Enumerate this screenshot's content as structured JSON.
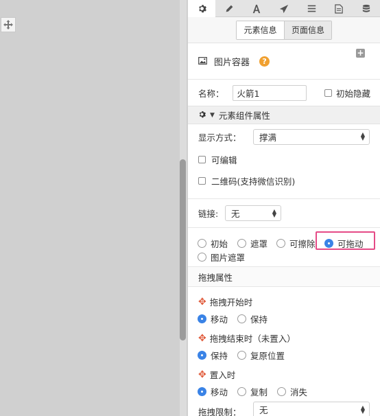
{
  "toolbar": {
    "tools": [
      "gear-icon",
      "pencil-icon",
      "text-icon",
      "send-icon",
      "list-icon",
      "document-icon",
      "database-icon"
    ],
    "active_index": 0
  },
  "tabs": {
    "element_info": "元素信息",
    "page_info": "页面信息"
  },
  "component": {
    "title": "图片容器",
    "help": "?",
    "add": "+"
  },
  "name_row": {
    "label": "名称：",
    "value": "火箭1",
    "initial_hide": "初始隐藏"
  },
  "group": {
    "title": "元素组件属性"
  },
  "display": {
    "label": "显示方式：",
    "value": "撑满"
  },
  "options": {
    "editable": "可编辑",
    "qrcode": "二维码(支持微信识别)"
  },
  "link": {
    "label": "链接:",
    "value": "无"
  },
  "mode": {
    "items": [
      "初始",
      "遮罩",
      "可擦除",
      "可拖动",
      "图片遮罩"
    ],
    "selected": "可拖动"
  },
  "drag": {
    "section_title": "拖拽属性",
    "start_title": "拖拽开始时",
    "start_options": [
      "移动",
      "保持"
    ],
    "start_selected": "移动",
    "end_title": "拖拽结束时（未置入）",
    "end_options": [
      "保持",
      "复原位置"
    ],
    "end_selected": "保持",
    "drop_title": "置入时",
    "drop_options": [
      "移动",
      "复制",
      "消失"
    ],
    "drop_selected": "移动",
    "limit_label": "拖拽限制：",
    "limit_value": "无"
  },
  "colors": {
    "accent": "#3a83e6",
    "highlight": "#e54a86",
    "help": "#f0a030",
    "drag_icon": "#e05a3a"
  }
}
